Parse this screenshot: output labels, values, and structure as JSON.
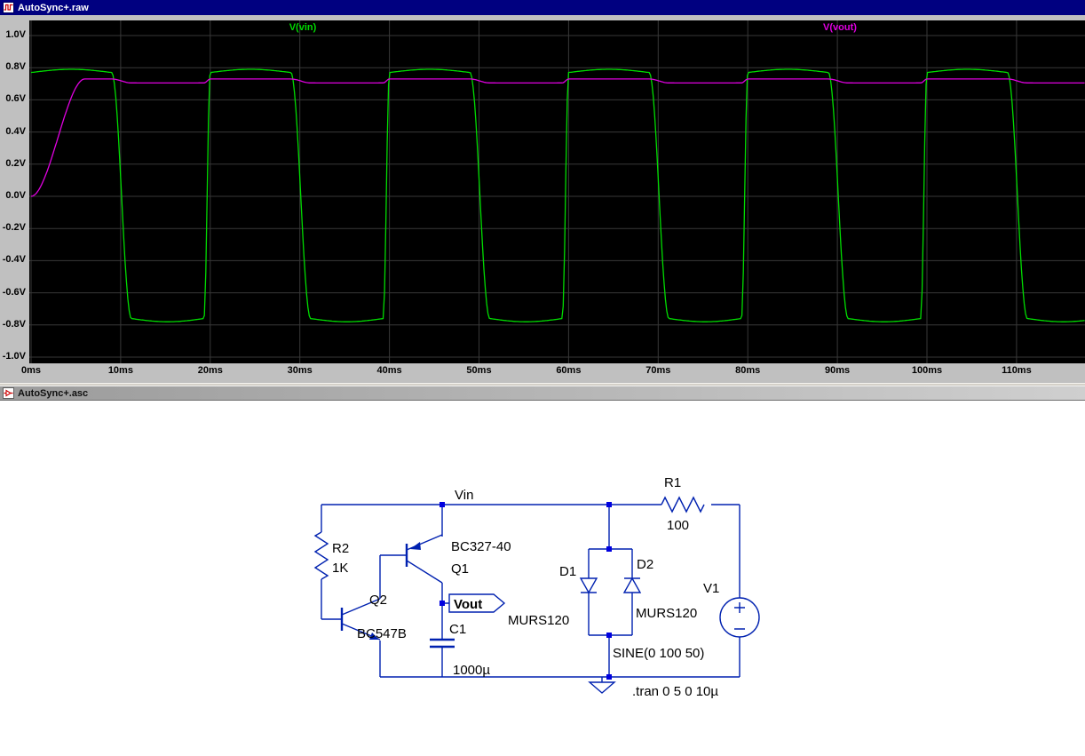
{
  "plot_window": {
    "title": "AutoSync+.raw"
  },
  "schematic_window": {
    "title": "AutoSync+.asc"
  },
  "chart_data": {
    "type": "line",
    "title": "",
    "background": "#000000",
    "grid_color": "#383838",
    "legend_position": "top",
    "x_ticks": [
      "0ms",
      "10ms",
      "20ms",
      "30ms",
      "40ms",
      "50ms",
      "60ms",
      "70ms",
      "80ms",
      "90ms",
      "100ms",
      "110ms"
    ],
    "y_ticks": [
      "1.0V",
      "0.8V",
      "0.6V",
      "0.4V",
      "0.2V",
      "0.0V",
      "-0.2V",
      "-0.4V",
      "-0.6V",
      "-0.8V",
      "-1.0V"
    ],
    "x_range_ms": [
      0,
      117.6
    ],
    "y_range_v": [
      -1.0,
      1.0
    ],
    "series": [
      {
        "name": "V(vin)",
        "color": "#00dc00",
        "waveform": {
          "kind": "rounded-square-oscillation",
          "period_ms": 20,
          "high_v": 0.79,
          "low_v": -0.78,
          "dome_v": 0.02,
          "fall_start_ms": 9,
          "fall_end_ms": 11.2,
          "rise_start_ms": 19.3
        }
      },
      {
        "name": "V(vout)",
        "color": "#e000e0",
        "waveform": {
          "kind": "settling-dc-with-ripple",
          "base_v": 0.705,
          "ripple_v": 0.025,
          "rise_ms": 6
        }
      }
    ]
  },
  "schematic": {
    "net_label": "Vin",
    "port_label": "Vout",
    "directive": ".tran 0 5 0 10µ",
    "components": {
      "r1": {
        "name": "R1",
        "value": "100"
      },
      "r2": {
        "name": "R2",
        "value": "1K"
      },
      "q1": {
        "name": "Q1",
        "model": "BC327-40"
      },
      "q2": {
        "name": "Q2",
        "model": "BC547B"
      },
      "c1": {
        "name": "C1",
        "value": "1000µ"
      },
      "d1": {
        "name": "D1",
        "model": "MURS120"
      },
      "d2": {
        "name": "D2",
        "model": "MURS120"
      },
      "v1": {
        "name": "V1",
        "value": "SINE(0 100 50)"
      }
    },
    "colors": {
      "wire": "#0021b0",
      "junction": "#0000e0",
      "text": "#000000"
    }
  }
}
